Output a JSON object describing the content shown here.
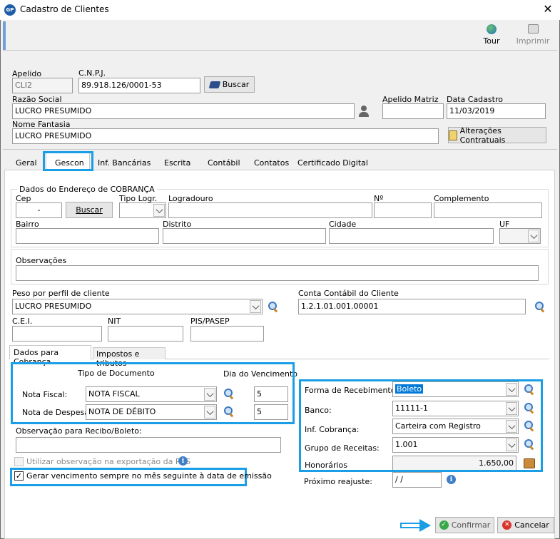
{
  "window": {
    "title": "Cadastro de Clientes",
    "icon_text": "GP"
  },
  "toolbar": {
    "tour_label": "Tour",
    "print_label": "Imprimir"
  },
  "header": {
    "apelido_label": "Apelido",
    "apelido_value": "CLI2",
    "cnpj_label": "C.N.P.J.",
    "cnpj_value": "89.918.126/0001-53",
    "buscar_label": "Buscar",
    "razao_label": "Razão Social",
    "razao_value": "LUCRO PRESUMIDO",
    "apelido_matriz_label": "Apelido Matriz",
    "apelido_matriz_value": "",
    "data_cadastro_label": "Data Cadastro",
    "data_cadastro_value": "11/03/2019",
    "fantasia_label": "Nome Fantasia",
    "fantasia_value": "LUCRO PRESUMIDO",
    "alteracoes_label": "Alterações Contratuais"
  },
  "tabs": [
    "Geral",
    "Gescon",
    "Inf. Bancárias",
    "Escrita",
    "Contábil",
    "Contatos",
    "Certificado Digital"
  ],
  "active_tab": "Gescon",
  "endereco": {
    "group_title": "Dados do Endereço de COBRANÇA",
    "cep_label": "Cep",
    "cep_value": "-",
    "buscar_label": "Buscar",
    "tipo_logr_label": "Tipo Logr.",
    "logradouro_label": "Logradouro",
    "numero_label": "Nº",
    "complemento_label": "Complemento",
    "bairro_label": "Bairro",
    "distrito_label": "Distrito",
    "cidade_label": "Cidade",
    "uf_label": "UF",
    "observacoes_label": "Observações"
  },
  "perfil": {
    "peso_label": "Peso por perfil de cliente",
    "peso_value": "LUCRO PRESUMIDO",
    "conta_label": "Conta Contábil do Cliente",
    "conta_value": "1.2.1.01.001.00001",
    "cei_label": "C.E.I.",
    "nit_label": "NIT",
    "pis_label": "PIS/PASEP"
  },
  "subtabs": [
    "Dados para Cobrança",
    "Impostos e tributos"
  ],
  "cobranca": {
    "tipo_doc_label": "Tipo de Documento",
    "dia_venc_label": "Dia do Vencimento",
    "nota_fiscal_label": "Nota Fiscal:",
    "nota_fiscal_value": "NOTA FISCAL",
    "nota_fiscal_dia": "5",
    "nota_despesa_label": "Nota de Despesa:",
    "nota_despesa_value": "NOTA DE DÉBITO",
    "nota_despesa_dia": "5",
    "obs_recibo_label": "Observação para Recibo/Boleto:",
    "utilizar_obs_label": "Utilizar observação na exportação da RPS",
    "gerar_venc_label": "Gerar vencimento sempre no mês seguinte à data de emissão",
    "forma_label": "Forma de Recebimento:",
    "forma_value": "Boleto",
    "banco_label": "Banco:",
    "banco_value": "11111-1",
    "inf_cobranca_label": "Inf. Cobrança:",
    "inf_cobranca_value": "Carteira com Registro",
    "grupo_label": "Grupo de Receitas:",
    "grupo_value": "1.001",
    "honorarios_label": "Honorários",
    "honorarios_value": "1.650,00",
    "reajuste_label": "Próximo reajuste:",
    "reajuste_value": "/ /"
  },
  "footer": {
    "confirmar_label": "Confirmar",
    "cancelar_label": "Cancelar"
  },
  "colors": {
    "highlight": "#1a9ee6",
    "selection": "#0078d7"
  }
}
